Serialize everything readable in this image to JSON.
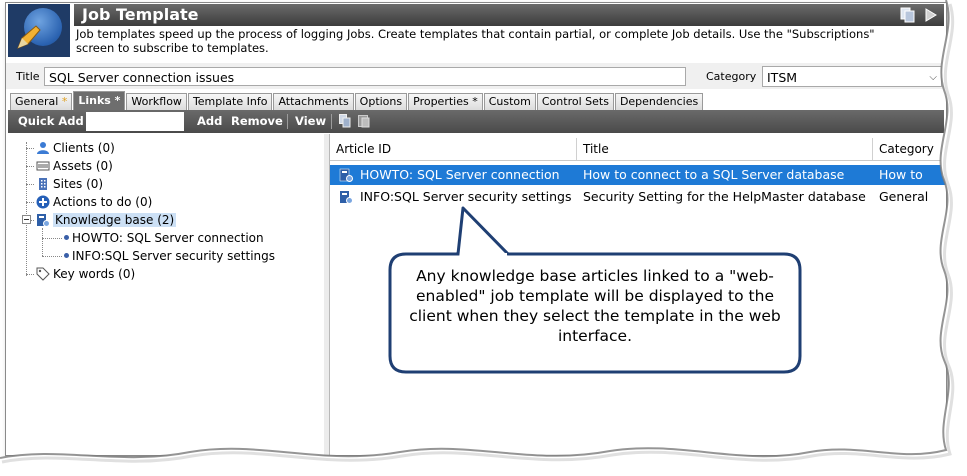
{
  "window": {
    "title": "Job Template",
    "description": "Job templates speed up the process of logging Jobs.  Create templates that contain partial, or complete Job details.  Use the \"Subscriptions\" screen to subscribe to templates."
  },
  "form": {
    "title_label": "Title",
    "title_value": "SQL Server connection issues",
    "category_label": "Category",
    "category_value": "ITSM"
  },
  "tabs": [
    {
      "label": "General",
      "star": "*"
    },
    {
      "label": "Links *",
      "star": ""
    },
    {
      "label": "Workflow",
      "star": ""
    },
    {
      "label": "Template Info",
      "star": ""
    },
    {
      "label": "Attachments",
      "star": ""
    },
    {
      "label": "Options",
      "star": ""
    },
    {
      "label": "Properties *",
      "star": ""
    },
    {
      "label": "Custom",
      "star": ""
    },
    {
      "label": "Control Sets",
      "star": ""
    },
    {
      "label": "Dependencies",
      "star": ""
    }
  ],
  "toolbar": {
    "quick_add_label": "Quick Add",
    "add_label": "Add",
    "remove_label": "Remove",
    "view_label": "View"
  },
  "tree": {
    "clients": "Clients (0)",
    "assets": "Assets (0)",
    "sites": "Sites (0)",
    "actions": "Actions to do (0)",
    "knowledge_base": "Knowledge base (2)",
    "kb_children": [
      "HOWTO: SQL Server connection",
      "INFO:SQL Server security settings"
    ],
    "keywords": "Key words (0)"
  },
  "grid": {
    "columns": [
      "Article ID",
      "Title",
      "Category"
    ],
    "rows": [
      {
        "article_id": "HOWTO: SQL Server connection",
        "title": "How to connect to a SQL Server database",
        "category": "How to"
      },
      {
        "article_id": "INFO:SQL Server security settings",
        "title": "Security Setting for the HelpMaster database",
        "category": "General"
      }
    ]
  },
  "callout": {
    "text": "Any knowledge base articles linked to a \"web-enabled\" job template will be displayed to the client when they select the template in the web interface."
  },
  "colors": {
    "selection": "#1e7ad6",
    "tree_selection": "#cce0f5",
    "callout_border": "#1f3f73",
    "titlebar": "#4a4a4a"
  }
}
